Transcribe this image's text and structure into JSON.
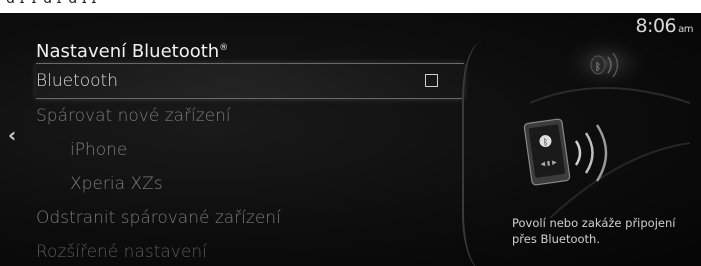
{
  "status": {
    "time": "8:06",
    "ampm": "am"
  },
  "menu": {
    "title": "Nastavení Bluetooth",
    "title_mark": "®",
    "items": [
      {
        "label": "Bluetooth"
      },
      {
        "label": "Spárovat nové zařízení"
      },
      {
        "label": "iPhone"
      },
      {
        "label": "Xperia XZs"
      },
      {
        "label": "Odstranit spárované zařízení"
      },
      {
        "label": "Rozšířené nastavení"
      }
    ]
  },
  "help": {
    "text": "Povolí nebo zakáže připojení přes Bluetooth."
  },
  "colors": {
    "accent": "#e6e6e6",
    "background": "#0d0d0d",
    "dim_text": "#7a7a7a"
  }
}
